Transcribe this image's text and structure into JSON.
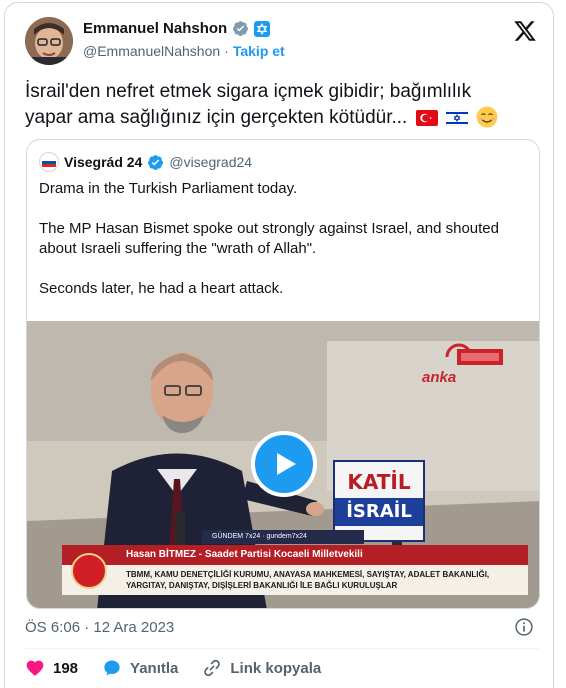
{
  "author": {
    "display_name": "Emmanuel Nahshon",
    "handle": "@EmmanuelNahshon",
    "separator": "·",
    "follow_label": "Takip et"
  },
  "tweet": {
    "text_line1": "İsrail'den nefret etmek sigara içmek gibidir; bağımlılık",
    "text_line2": "yapar ama sağlığınız için gerçekten kötüdür..."
  },
  "quote": {
    "display_name": "Visegrád 24",
    "handle": "@visegrad24",
    "paragraphs": [
      "Drama in the Turkish Parliament today.",
      "The MP Hasan Bismet spoke out strongly against Israel, and shouted about Israeli suffering the \"wrath of Allah\".",
      "Seconds later, he had a heart attack."
    ],
    "video": {
      "lower_third_name": "Hasan BİTMEZ - Saadet Partisi Kocaeli Milletvekili",
      "lower_third_topic_1": "TBMM, KAMU DENETÇİLİĞİ KURUMU, ANAYASA MAHKEMESİ, SAYIŞTAY, ADALET BAKANLIĞI,",
      "lower_third_topic_2": "YARGITAY, DANIŞTAY, DIŞİŞLERİ BAKANLIĞI İLE BAĞLI KURULUŞLAR",
      "sign_line1": "KATİL",
      "sign_line2": "İSRAİL",
      "channel_name": "anka",
      "gundem_text": "GÜNDEM 7x24 · gundem7x24"
    }
  },
  "timestamp": "ÖS 6:06 · 12 Ara 2023",
  "actions": {
    "likes": "198",
    "reply_label": "Yanıtla",
    "copy_link_label": "Link kopyala"
  },
  "colors": {
    "accent": "#1d9bf0",
    "like": "#f91880",
    "muted": "#536471"
  }
}
